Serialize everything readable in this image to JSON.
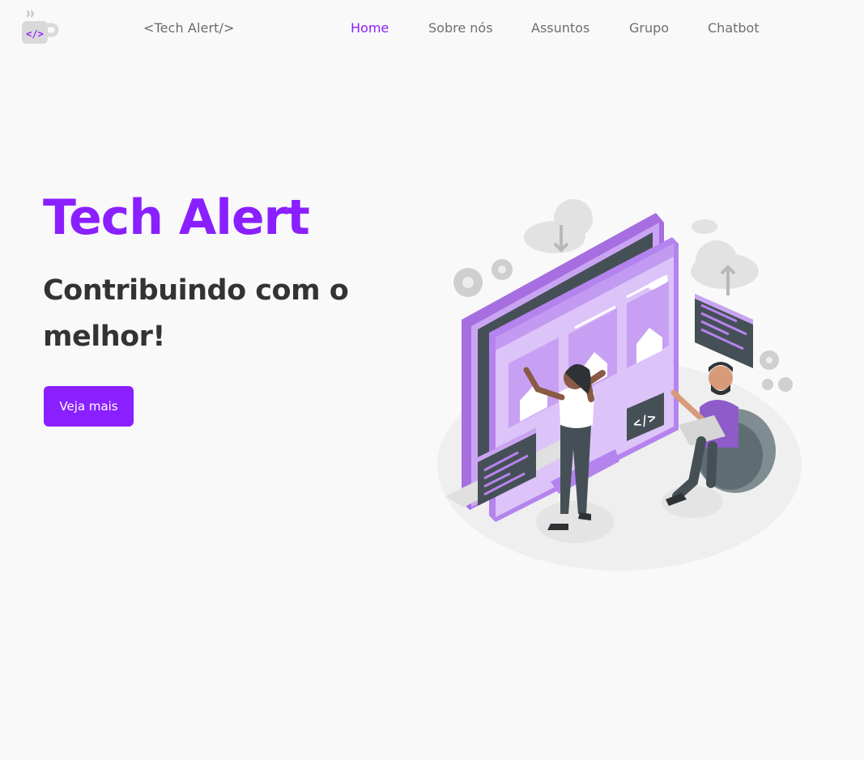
{
  "header": {
    "brand": "<Tech Alert/>",
    "nav": [
      {
        "label": "Home",
        "active": true
      },
      {
        "label": "Sobre nós",
        "active": false
      },
      {
        "label": "Assuntos",
        "active": false
      },
      {
        "label": "Grupo",
        "active": false
      },
      {
        "label": "Chatbot",
        "active": false
      }
    ]
  },
  "hero": {
    "title": "Tech Alert",
    "subtitle": "Contribuindo com o melhor!",
    "cta_label": "Veja mais"
  },
  "colors": {
    "accent": "#8a20ff",
    "text_dark": "#333333",
    "nav_text": "#6f6f6f",
    "background": "#f9f9f9"
  },
  "icons": {
    "logo": "coffee-cup-code-icon",
    "monitor_code_badge": "</>"
  }
}
